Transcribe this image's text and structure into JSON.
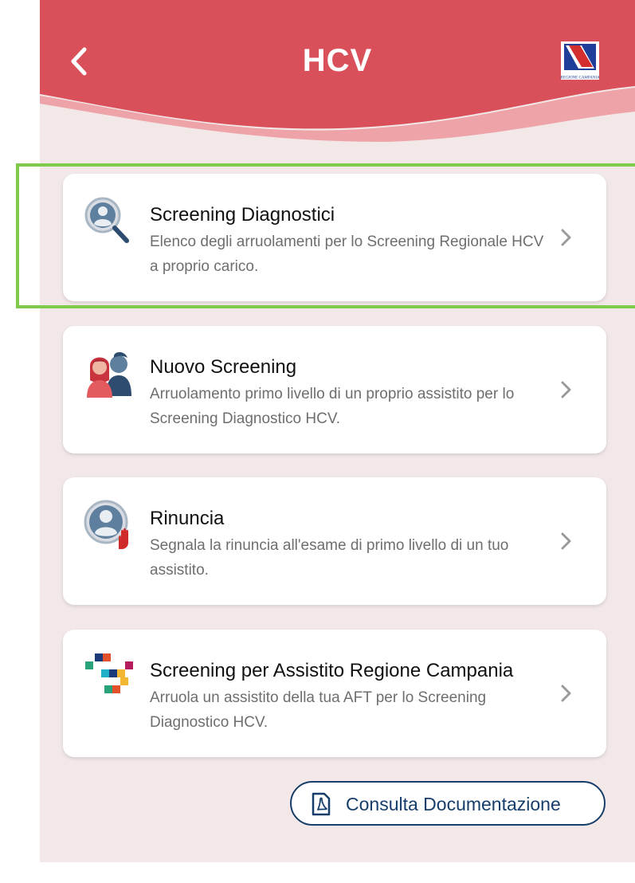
{
  "header": {
    "title": "HCV",
    "logo_text": "REGIONE CAMPANIA",
    "colors": {
      "primary": "#d9505a",
      "wave_light": "#eea3a8"
    }
  },
  "cards": [
    {
      "title": "Screening Diagnostici",
      "description": "Elenco degli arruolamenti per lo Screening Regionale HCV a proprio carico.",
      "icon": "search-person-icon"
    },
    {
      "title": "Nuovo Screening",
      "description": "Arruolamento primo livello di un proprio assistito per lo Screening Diagnostico HCV.",
      "icon": "people-icon"
    },
    {
      "title": "Rinuncia",
      "description": "Segnala la rinuncia all'esame di primo livello di un tuo assistito.",
      "icon": "person-stop-icon"
    },
    {
      "title": "Screening per Assistito Regione Campania",
      "description": "Arruola un assistito della tua AFT per lo Screening Diagnostico HCV.",
      "icon": "colored-squares-icon"
    }
  ],
  "docs_button": {
    "label": "Consulta Documentazione",
    "icon": "pdf-icon",
    "color": "#173e6b"
  },
  "highlight_color": "#7fc94b"
}
